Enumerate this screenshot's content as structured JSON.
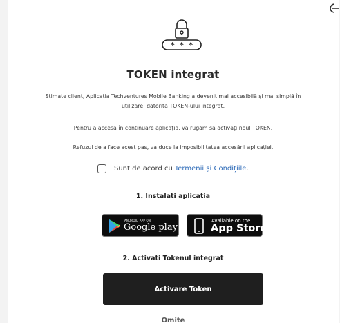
{
  "header": {
    "logout_icon": "logout-icon"
  },
  "hero": {
    "icon": "lock-password-icon",
    "mask": "* * *"
  },
  "title": "TOKEN integrat",
  "intro": {
    "line1": "Stimate client, Aplicația Techventures Mobile Banking a devenit mai accesibilă și mai simplă în",
    "line2": "utilizare, datorită TOKEN-ului integrat."
  },
  "instruction": "Pentru a accesa în continuare aplicația, vă rugăm să activați noul TOKEN.",
  "warning": "Refuzul de a face acest pas, va duce la imposibilitatea accesării aplicației.",
  "agreement": {
    "label": "Sunt de acord cu",
    "link": "Termenii și Condițiile",
    "suffix": ".",
    "checked": false
  },
  "step1": {
    "title": "1. Instalati aplicatia",
    "google_play": {
      "small": "ANDROID APP ON",
      "big": "Google play"
    },
    "app_store": {
      "small": "Available on the",
      "big": "App Store"
    }
  },
  "step2": {
    "title": "2. Activati Tokenul integrat",
    "button": "Activare Token"
  },
  "skip": "Omite",
  "colors": {
    "link": "#2e6bb8",
    "button_bg": "#1f1f1f"
  }
}
